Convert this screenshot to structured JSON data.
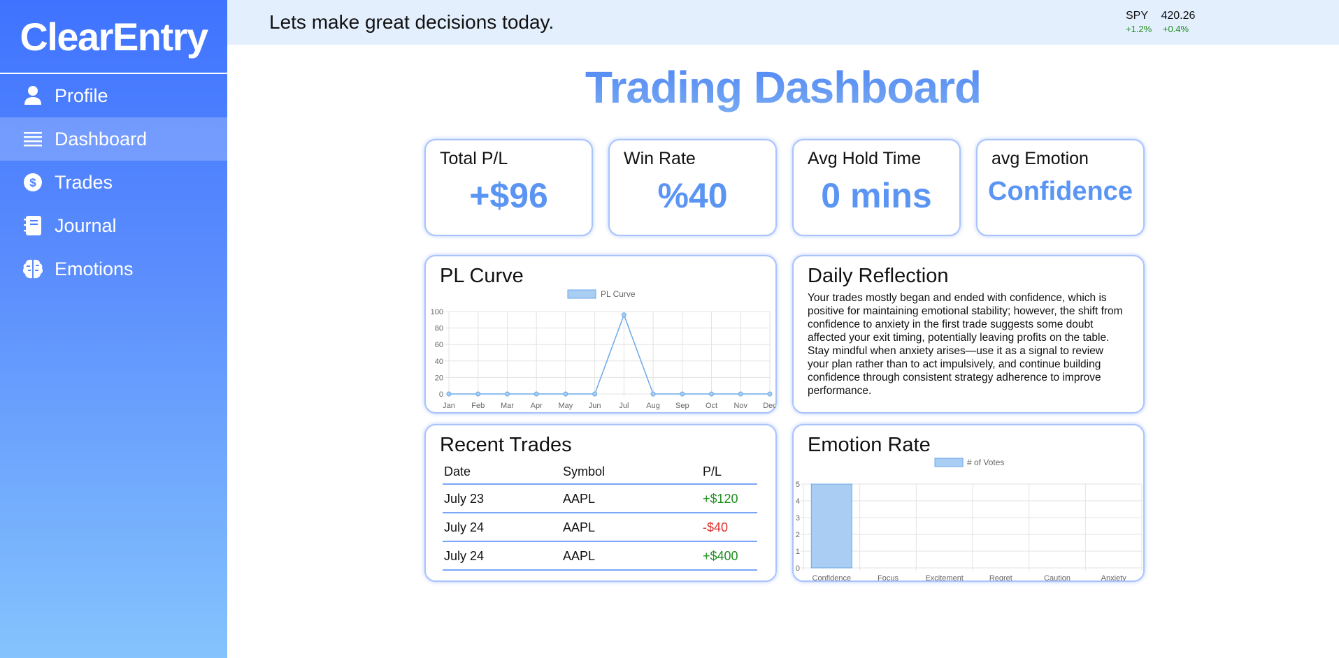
{
  "sidebar": {
    "brand": "ClearEntry",
    "items": [
      {
        "label": "Profile",
        "icon": "person-icon",
        "active": false
      },
      {
        "label": "Dashboard",
        "icon": "list-icon",
        "active": true
      },
      {
        "label": "Trades",
        "icon": "dollar-icon",
        "active": false
      },
      {
        "label": "Journal",
        "icon": "journal-icon",
        "active": false
      },
      {
        "label": "Emotions",
        "icon": "brain-icon",
        "active": false
      }
    ]
  },
  "topbar": {
    "greeting": "Lets make great decisions today.",
    "ticker": {
      "symbol": "SPY",
      "price": "420.26",
      "change1": "+1.2%",
      "change2": "+0.4%"
    }
  },
  "page": {
    "title": "Trading Dashboard"
  },
  "stats": [
    {
      "label": "Total P/L",
      "value": "+$96"
    },
    {
      "label": "Win Rate",
      "value": "%40"
    },
    {
      "label": "Avg Hold Time",
      "value": "0 mins"
    },
    {
      "label": "avg Emotion",
      "value": "Confidence"
    }
  ],
  "pl_curve": {
    "title": "PL Curve"
  },
  "reflection": {
    "title": "Daily Reflection",
    "text": "Your trades mostly began and ended with confidence, which is positive for maintaining emotional stability; however, the shift from confidence to anxiety in the first trade suggests some doubt affected your exit timing, potentially leaving profits on the table. Stay mindful when anxiety arises—use it as a signal to review your plan rather than to act impulsively, and continue building confidence through consistent strategy adherence to improve performance."
  },
  "recent_trades": {
    "title": "Recent Trades",
    "headers": [
      "Date",
      "Symbol",
      "P/L"
    ],
    "rows": [
      {
        "date": "July 23",
        "symbol": "AAPL",
        "pl": "+$120",
        "positive": true
      },
      {
        "date": "July 24",
        "symbol": "AAPL",
        "pl": "-$40",
        "positive": false
      },
      {
        "date": "July 24",
        "symbol": "AAPL",
        "pl": "+$400",
        "positive": true
      }
    ]
  },
  "emotion_rate": {
    "title": "Emotion Rate"
  },
  "chart_data": [
    {
      "type": "line",
      "legend": "PL Curve",
      "categories": [
        "Jan",
        "Feb",
        "Mar",
        "Apr",
        "May",
        "Jun",
        "Jul",
        "Aug",
        "Sep",
        "Oct",
        "Nov",
        "Dec"
      ],
      "series": [
        {
          "name": "PL Curve",
          "values": [
            0,
            0,
            0,
            0,
            0,
            0,
            96,
            0,
            0,
            0,
            0,
            0
          ]
        }
      ],
      "ylim": [
        0,
        100
      ],
      "yticks": [
        0,
        20,
        40,
        60,
        80,
        100
      ],
      "grid": true,
      "legend_position": "top",
      "color": "#6aa9e9"
    },
    {
      "type": "bar",
      "legend": "# of Votes",
      "categories": [
        "Confidence",
        "Focus",
        "Excitement",
        "Regret",
        "Caution",
        "Anxiety"
      ],
      "series": [
        {
          "name": "# of Votes",
          "values": [
            5,
            0,
            0,
            0,
            0,
            0
          ]
        }
      ],
      "ylim": [
        0,
        5
      ],
      "yticks": [
        0,
        1,
        2,
        3,
        4,
        5
      ],
      "grid": true,
      "legend_position": "top",
      "color": "#a9cdf3"
    }
  ]
}
